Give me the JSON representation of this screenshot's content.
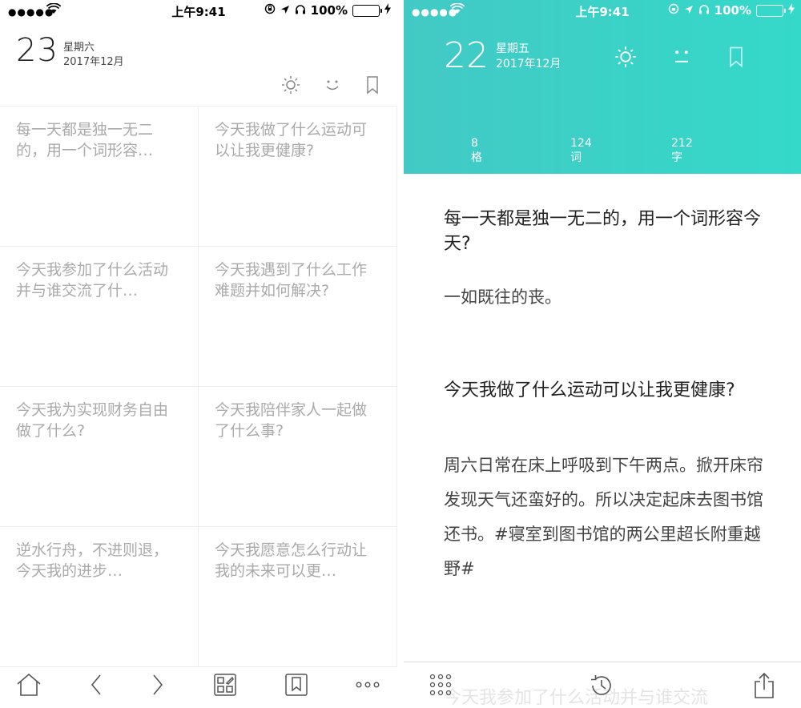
{
  "left": {
    "status": {
      "signal": "●●●●●",
      "time": "上午9:41",
      "battery": "100%"
    },
    "date": {
      "day": "23",
      "weekday": "星期六",
      "month": "2017年12月"
    },
    "header_icons": [
      "sun-icon",
      "smile-icon",
      "bookmark-icon"
    ],
    "prompts": [
      "每一天都是独一无二的，用一个词形容…",
      "今天我做了什么运动可以让我更健康?",
      "今天我参加了什么活动并与谁交流了什…",
      "今天我遇到了什么工作难题并如何解决?",
      "今天我为实现财务自由做了什么?",
      "今天我陪伴家人一起做了什么事?",
      "逆水行舟，不进则退，今天我的进步…",
      "今天我愿意怎么行动让我的未来可以更…"
    ],
    "toolbar_icons": [
      "home-icon",
      "back-icon",
      "forward-icon",
      "grid-edit-icon",
      "bookmark-icon",
      "more-icon"
    ]
  },
  "right": {
    "status": {
      "signal": "●●●●●",
      "time": "上午9:41",
      "battery": "100%"
    },
    "date": {
      "day": "22",
      "weekday": "星期五",
      "month": "2017年12月"
    },
    "header_icons": [
      "sun-icon",
      "neutral-face-icon",
      "bookmark-icon"
    ],
    "stats": [
      {
        "value": "8",
        "unit": "格"
      },
      {
        "value": "124",
        "unit": "词"
      },
      {
        "value": "212",
        "unit": "字"
      }
    ],
    "entries": [
      {
        "question": "每一天都是独一无二的，用一个词形容今天?",
        "answer": "一如既往的丧。"
      },
      {
        "question": "今天我做了什么运动可以让我更健康?",
        "answer": "周六日常在床上呼吸到下午两点。掀开床帘发现天气还蛮好的。所以决定起床去图书馆还书。#寝室到图书馆的两公里超长附重越野#"
      }
    ],
    "peek_text": "今天我参加了什么活动并与谁交流",
    "toolbar_icons": [
      "dot-grid-icon",
      "history-icon",
      "share-icon"
    ]
  },
  "colors": {
    "accent_start": "#43c9c5",
    "accent_end": "#34d9c9",
    "battery_green": "#4cd964"
  }
}
